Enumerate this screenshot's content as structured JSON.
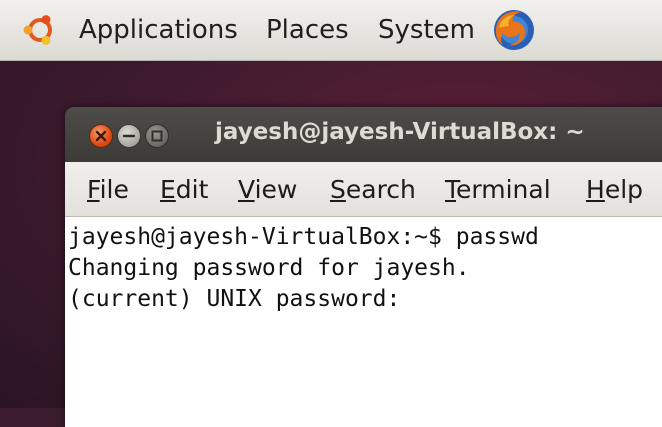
{
  "top_panel": {
    "menus": [
      "Applications",
      "Places",
      "System"
    ],
    "icons": {
      "logo": "ubuntu-logo-icon",
      "browser": "firefox-icon"
    }
  },
  "window": {
    "title": "jayesh@jayesh-VirtualBox: ~",
    "menu": [
      {
        "first": "F",
        "rest": "ile"
      },
      {
        "first": "E",
        "rest": "dit"
      },
      {
        "first": "V",
        "rest": "iew"
      },
      {
        "first": "S",
        "rest": "earch"
      },
      {
        "first": "T",
        "rest": "erminal"
      },
      {
        "first": "H",
        "rest": "elp"
      }
    ]
  },
  "terminal": {
    "lines": [
      "jayesh@jayesh-VirtualBox:~$ passwd",
      "Changing password for jayesh.",
      "(current) UNIX password:"
    ]
  },
  "colors": {
    "desktop": "#3d1a2e",
    "close_button": "#df4a16",
    "titlebar": "#3c3b37"
  }
}
